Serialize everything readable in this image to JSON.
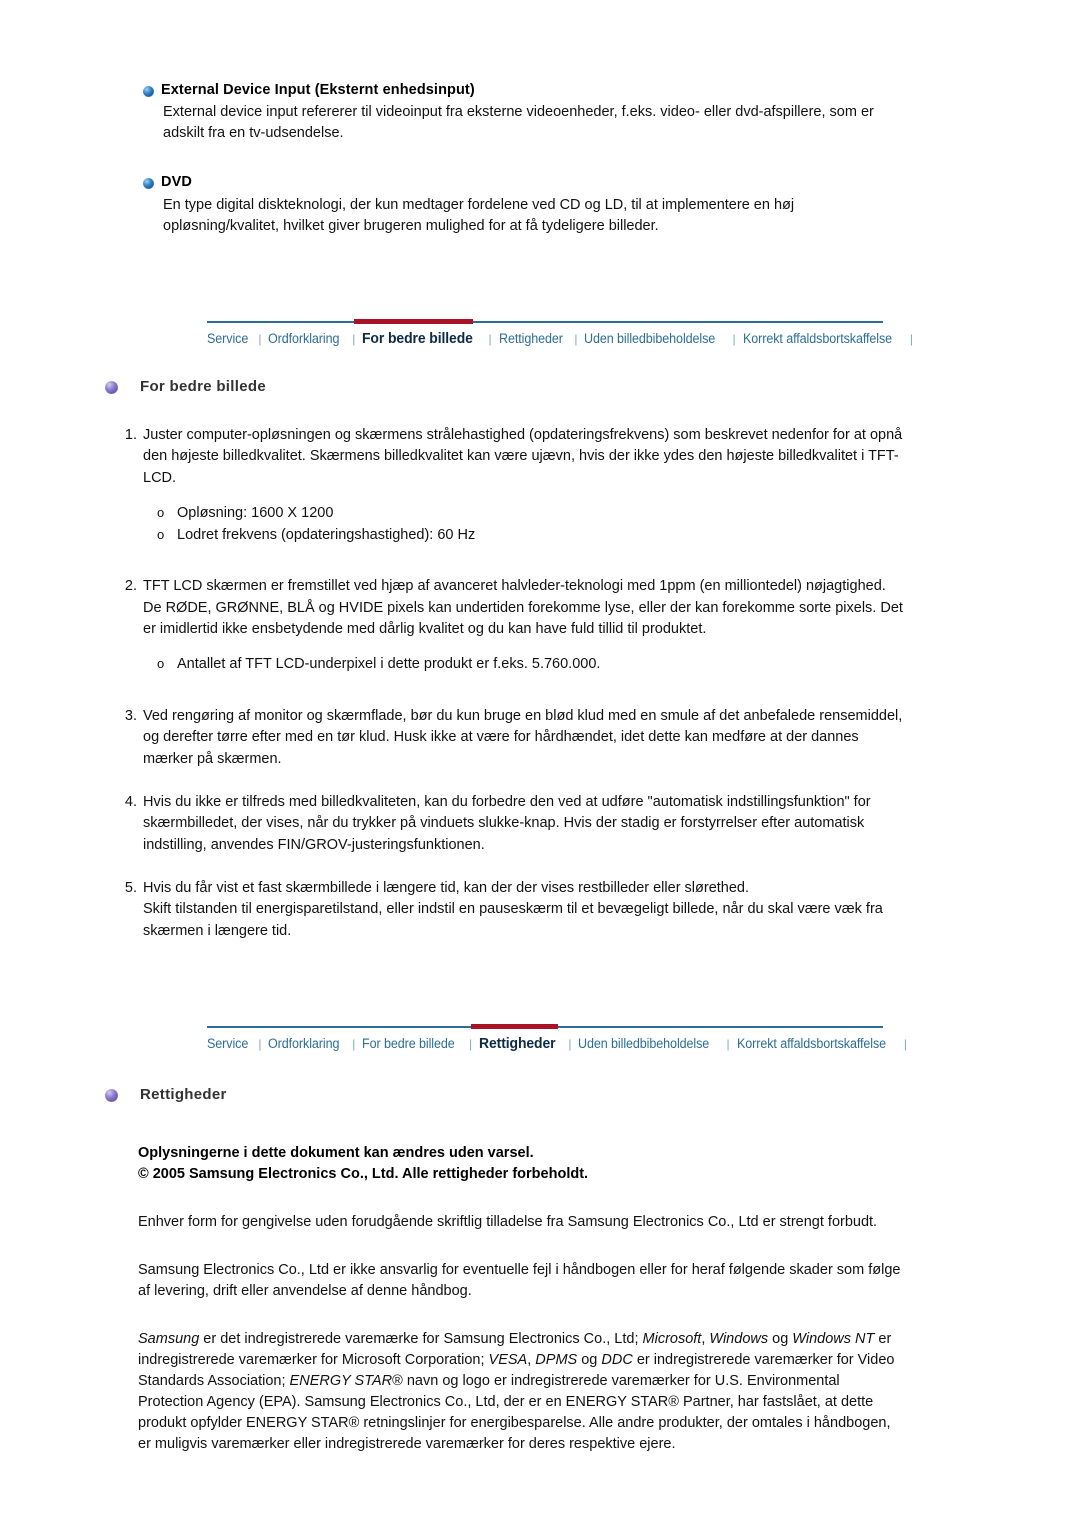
{
  "glossary": {
    "entries": [
      {
        "bullet": "blue-sphere-bullet-icon",
        "title": "External Device Input (Eksternt enhedsinput)",
        "body": "External device input refererer til videoinput fra eksterne videoenheder, f.eks. video- eller dvd-afspillere, som er adskilt fra en tv-udsendelse."
      },
      {
        "bullet": "blue-sphere-bullet-icon",
        "title": "DVD",
        "body": "En type digital diskteknologi, der kun medtager fordelene ved CD og LD, til at implementere en høj opløsning/kvalitet, hvilket giver brugeren mulighed for at få tydeligere billeder."
      }
    ]
  },
  "nav_one": {
    "active_index": 2,
    "accent_color": "#a81325",
    "link_color": "#2e6e94",
    "items": [
      {
        "label": "Service"
      },
      {
        "label": "Ordforklaring"
      },
      {
        "label": "For bedre billede"
      },
      {
        "label": "Rettigheder"
      },
      {
        "label": "Uden billedbibeholdelse"
      },
      {
        "label": "Korrekt affaldsbortskaffelse"
      }
    ],
    "separator": "|"
  },
  "nav_two": {
    "active_index": 3,
    "accent_color": "#a81325",
    "link_color": "#2e6e94",
    "items": [
      {
        "label": "Service"
      },
      {
        "label": "Ordforklaring"
      },
      {
        "label": "For bedre billede"
      },
      {
        "label": "Rettigheder"
      },
      {
        "label": "Uden billedbibeholdelse"
      },
      {
        "label": "Korrekt affaldsbortskaffelse"
      }
    ],
    "separator": "|"
  },
  "section_image": {
    "bullet": "purple-sphere-bullet-icon",
    "title": "For bedre billede",
    "items": [
      {
        "number": "1.",
        "text": "Juster computer-opløsningen og skærmens strålehastighed (opdateringsfrekvens) som beskrevet nedenfor for at opnå den højeste billedkvalitet. Skærmens billedkvalitet kan være ujævn, hvis der ikke ydes den højeste billedkvalitet i TFT-LCD.",
        "sub": [
          {
            "marker": "o",
            "text": "Opløsning: 1600 X 1200"
          },
          {
            "marker": "o",
            "text": "Lodret frekvens (opdateringshastighed): 60 Hz"
          }
        ]
      },
      {
        "number": "2.",
        "text": "TFT LCD skærmen er fremstillet ved hjæp af avanceret halvleder-teknologi med 1ppm (en milliontedel) nøjagtighed. De RØDE, GRØNNE, BLÅ og HVIDE pixels kan undertiden forekomme lyse, eller der kan forekomme sorte pixels. Det er imidlertid ikke ensbetydende med dårlig kvalitet og du kan have fuld tillid til produktet.",
        "sub": [
          {
            "marker": "o",
            "text": "Antallet af TFT LCD-underpixel i dette produkt er f.eks. 5.760.000."
          }
        ]
      },
      {
        "number": "3.",
        "text": "Ved rengøring af monitor og skærmflade, bør du kun bruge en blød klud med en smule af det anbefalede rensemiddel, og derefter tørre efter med en tør klud. Husk ikke at være for hårdhændet, idet dette kan medføre at der dannes mærker på skærmen.",
        "sub": []
      },
      {
        "number": "4.",
        "text": "Hvis du ikke er tilfreds med billedkvaliteten, kan du forbedre den ved at udføre \"automatisk indstillingsfunktion\" for skærmbilledet, der vises, når du trykker på vinduets slukke-knap. Hvis der stadig er forstyrrelser efter automatisk indstilling, anvendes FIN/GROV-justeringsfunktionen.",
        "sub": []
      },
      {
        "number": "5.",
        "text": "Hvis du får vist et fast skærmbillede i længere tid, kan der der vises restbilleder eller slørethed.\nSkift tilstanden til energisparetilstand, eller indstil en pauseskærm til et bevægeligt billede, når du skal være væk fra skærmen i længere tid.",
        "sub": []
      }
    ]
  },
  "section_rights": {
    "bullet": "purple-sphere-bullet-icon",
    "title": "Rettigheder",
    "notice_line_1": "Oplysningerne i dette dokument kan ændres uden varsel.",
    "notice_line_2": "© 2005 Samsung Electronics Co., Ltd. Alle rettigheder forbeholdt.",
    "paragraph_1": "Enhver form for gengivelse uden forudgående skriftlig tilladelse fra Samsung Electronics Co., Ltd er strengt forbudt.",
    "paragraph_2": "Samsung Electronics Co., Ltd er ikke ansvarlig for eventuelle fejl i håndbogen eller for heraf følgende skader som følge af levering, drift eller anvendelse af denne håndbog.",
    "trademark": {
      "t1": "Samsung",
      "s1": " er det indregistrerede varemærke for Samsung Electronics Co., Ltd; ",
      "t2": "Microsoft",
      "s2": ", ",
      "t3": "Windows",
      "s3": " og ",
      "t4": "Windows NT",
      "s4": " er indregistrerede varemærker for Microsoft Corporation; ",
      "t5": "VESA",
      "s5": ", ",
      "t6": "DPMS",
      "s6": " og ",
      "t7": "DDC",
      "s7": " er indregistrerede varemærker for Video Standards Association; ",
      "t8": "ENERGY STAR",
      "s8": "® navn og logo er indregistrerede varemærker for U.S. Environmental Protection Agency (EPA). Samsung Electronics Co., Ltd, der er en ENERGY STAR® Partner, har fastslået, at dette produkt opfylder ENERGY STAR® retningslinjer for energibesparelse. Alle andre produkter, der omtales i håndbogen, er muligvis varemærker eller indregistrerede varemærker for deres respektive ejere."
    }
  }
}
